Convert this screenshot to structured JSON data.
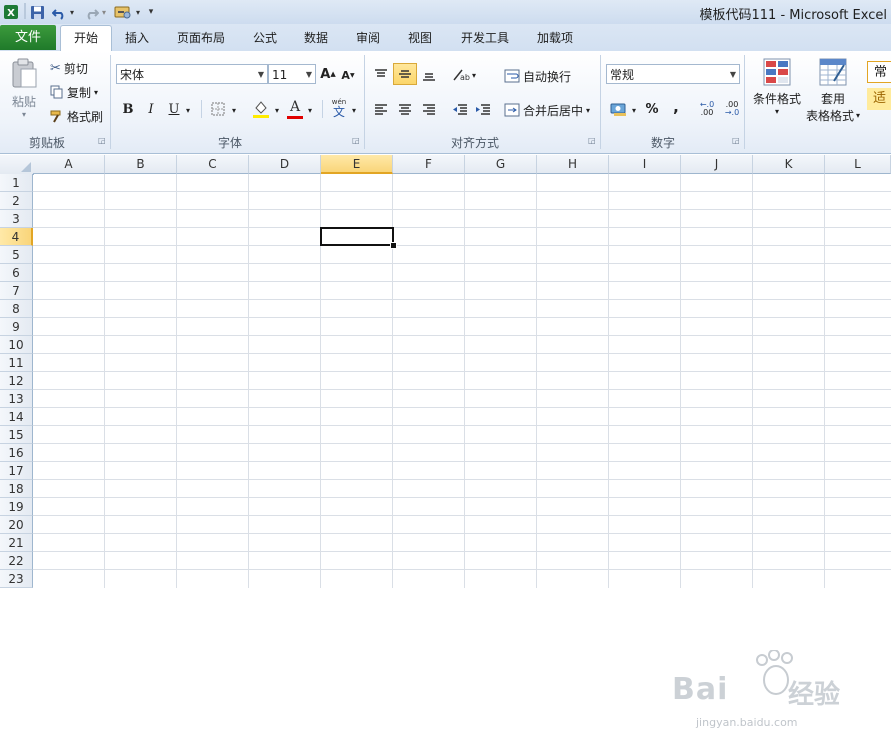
{
  "window": {
    "title": "模板代码111  -  Microsoft Excel"
  },
  "tabs": [
    {
      "label": "文件",
      "active": false
    },
    {
      "label": "开始",
      "active": true
    },
    {
      "label": "插入"
    },
    {
      "label": "页面布局"
    },
    {
      "label": "公式"
    },
    {
      "label": "数据"
    },
    {
      "label": "审阅"
    },
    {
      "label": "视图"
    },
    {
      "label": "开发工具"
    },
    {
      "label": "加载项"
    }
  ],
  "clipboard": {
    "paste": "粘贴",
    "cut": "剪切",
    "copy": "复制",
    "format_painter": "格式刷",
    "group_label": "剪贴板"
  },
  "font": {
    "name": "宋体",
    "size": "11",
    "bold": "B",
    "italic": "I",
    "underline": "U",
    "font_color_glyph": "A",
    "phonetic_glyph": "wén",
    "group_label": "字体"
  },
  "alignment": {
    "wrap_text": "自动换行",
    "merge_center": "合并后居中",
    "group_label": "对齐方式"
  },
  "number": {
    "format": "常规",
    "percent": "%",
    "comma": ",",
    "inc_decimal": ".00",
    "dec_decimal": ".00",
    "group_label": "数字"
  },
  "styles": {
    "conditional_format": "条件格式",
    "table_format_line1": "套用",
    "table_format_line2": "表格格式",
    "cell_style_1": "常",
    "cell_style_2": "适"
  },
  "sheet": {
    "columns": [
      "A",
      "B",
      "C",
      "D",
      "E",
      "F",
      "G",
      "H",
      "I",
      "J",
      "K",
      "L"
    ],
    "rows": [
      "1",
      "2",
      "3",
      "4",
      "5",
      "6",
      "7",
      "8",
      "9",
      "10",
      "11",
      "12",
      "13",
      "14",
      "15",
      "16",
      "17",
      "18",
      "19",
      "20",
      "21",
      "22",
      "23"
    ],
    "selected_column": "E",
    "selected_row": "4"
  },
  "watermark": {
    "brand": "Bai",
    "brand2": "经验",
    "url": "jingyan.baidu.com"
  },
  "colors": {
    "accent_file_tab": "#1f7a2a",
    "selection_header": "#f9d57a",
    "gridline": "#dadfe6"
  }
}
